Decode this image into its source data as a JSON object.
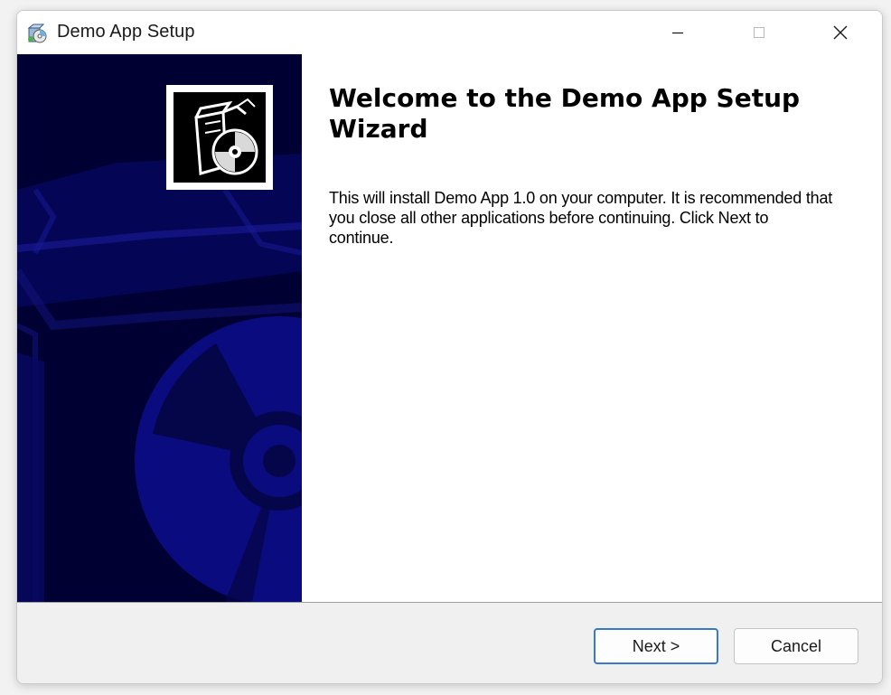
{
  "window": {
    "title": "Demo App Setup",
    "controls": {
      "minimize": "minimize-icon",
      "maximize": "maximize-icon",
      "close": "close-icon"
    }
  },
  "sidebar": {
    "background_color": "#000033",
    "artwork_color": "#10108c",
    "logo": "setup-box-cd-icon"
  },
  "content": {
    "heading": "Welcome to the Demo App Setup Wizard",
    "body": "This will install Demo App 1.0 on your computer. It is recommended that you close all other applications before continuing. Click Next to continue."
  },
  "footer": {
    "next_label": "Next >",
    "cancel_label": "Cancel"
  },
  "colors": {
    "accent_focus": "#3a78c9"
  }
}
